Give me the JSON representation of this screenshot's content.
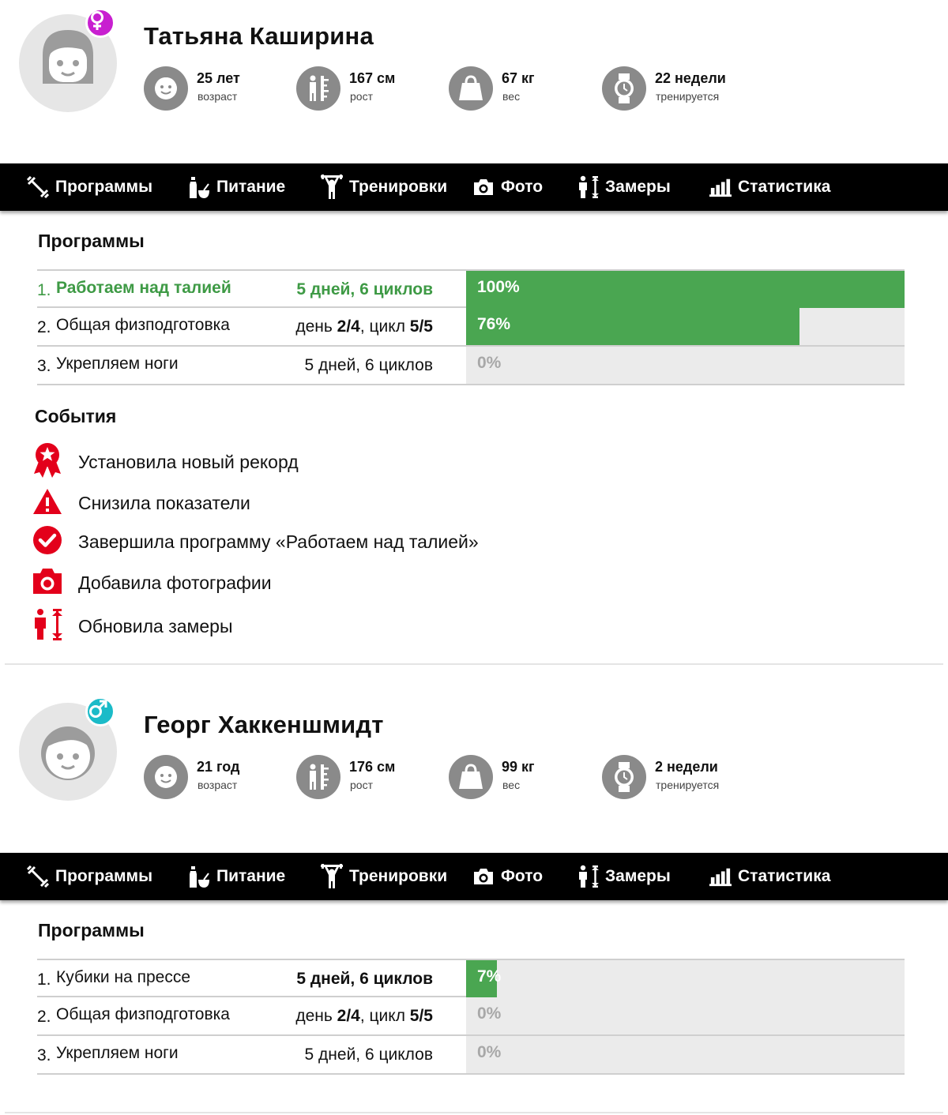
{
  "colors": {
    "accent_green": "#4aa651",
    "active_text_green": "#3e9a45",
    "event_red": "#e3001b",
    "female_badge": "#c81fd0",
    "male_badge": "#1bbbc8",
    "stat_icon_bg": "#8a8a8a",
    "navbar_bg": "#000000"
  },
  "nav": [
    {
      "label": "Программы",
      "icon": "dumbbell-icon"
    },
    {
      "label": "Питание",
      "icon": "bottle-bowl-icon"
    },
    {
      "label": "Тренировки",
      "icon": "weightlifter-icon"
    },
    {
      "label": "Фото",
      "icon": "camera-icon"
    },
    {
      "label": "Замеры",
      "icon": "height-measure-icon"
    },
    {
      "label": "Статистика",
      "icon": "bar-chart-icon"
    }
  ],
  "profiles": [
    {
      "name": "Татьяна Каширина",
      "gender": "female",
      "gender_symbol": "♀",
      "stats": [
        {
          "value": "25 лет",
          "label": "возраст",
          "icon": "face-icon"
        },
        {
          "value": "167 см",
          "label": "рост",
          "icon": "ruler-person-icon"
        },
        {
          "value": "67 кг",
          "label": "вес",
          "icon": "weight-icon"
        },
        {
          "value": "22 недели",
          "label": "тренируется",
          "icon": "watch-icon"
        }
      ],
      "programs_title": "Программы",
      "programs": [
        {
          "num": "1.",
          "name": "Работаем над талией",
          "schedule": "5 дней, 6 циклов",
          "percent_label": "100%",
          "progress": 100,
          "active": true
        },
        {
          "num": "2.",
          "name": "Общая физподготовка",
          "schedule_parts": [
            "день ",
            "2/4",
            ", цикл ",
            "5/5"
          ],
          "percent_label": "76%",
          "progress": 76,
          "active": false
        },
        {
          "num": "3.",
          "name": "Укрепляем ноги",
          "schedule": "5 дней, 6 циклов",
          "percent_label": "0%",
          "progress": 0,
          "active": false
        }
      ],
      "events_title": "События",
      "events": [
        {
          "text": "Установила новый рекорд",
          "icon": "award-ribbon-icon"
        },
        {
          "text": "Снизила показатели",
          "icon": "warning-icon"
        },
        {
          "text": "Завершила программу «Работаем над талией»",
          "icon": "check-circle-icon"
        },
        {
          "text": "Добавила фотографии",
          "icon": "camera-icon"
        },
        {
          "text": "Обновила замеры",
          "icon": "height-measure-icon"
        }
      ]
    },
    {
      "name": "Георг Хаккеншмидт",
      "gender": "male",
      "gender_symbol": "♂",
      "stats": [
        {
          "value": "21 год",
          "label": "возраст",
          "icon": "face-icon"
        },
        {
          "value": "176 см",
          "label": "рост",
          "icon": "ruler-person-icon"
        },
        {
          "value": "99 кг",
          "label": "вес",
          "icon": "weight-icon"
        },
        {
          "value": "2 недели",
          "label": "тренируется",
          "icon": "watch-icon"
        }
      ],
      "programs_title": "Программы",
      "programs": [
        {
          "num": "1.",
          "name": "Кубики на прессе",
          "schedule": "5 дней, 6 циклов",
          "percent_label": "7%",
          "progress": 7,
          "active": false,
          "schedule_bold": true
        },
        {
          "num": "2.",
          "name": "Общая физподготовка",
          "schedule_parts": [
            "день ",
            "2/4",
            ", цикл ",
            "5/5"
          ],
          "percent_label": "0%",
          "progress": 0,
          "active": false
        },
        {
          "num": "3.",
          "name": "Укрепляем ноги",
          "schedule": "5 дней, 6 циклов",
          "percent_label": "0%",
          "progress": 0,
          "active": false
        }
      ]
    }
  ]
}
